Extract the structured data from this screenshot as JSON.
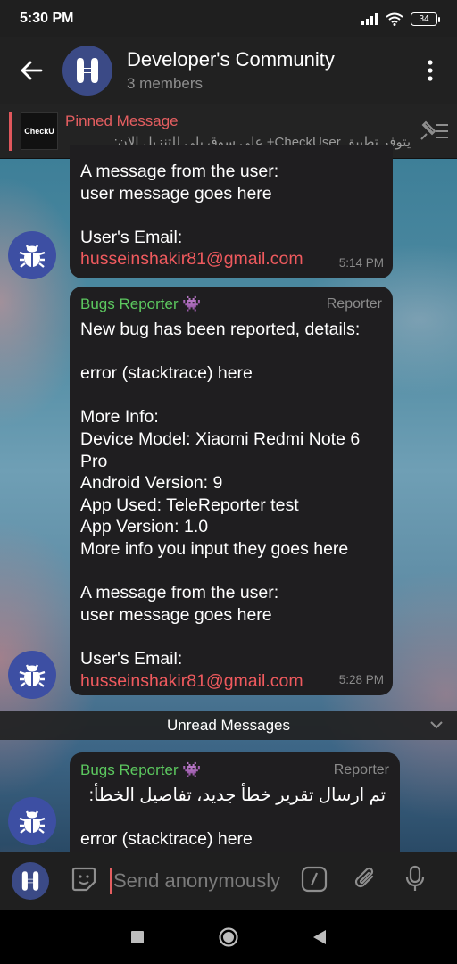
{
  "status_bar": {
    "time": "5:30 PM",
    "battery": "34"
  },
  "header": {
    "title": "Developer's Community",
    "subtitle": "3 members"
  },
  "pinned": {
    "label": "Pinned Message",
    "thumb_text": "CheckU",
    "text": "يتوفر تطبيق CheckUser+ على سوق بلي للتنزيل الان:..."
  },
  "messages": [
    {
      "lines": [
        "A message from the user:",
        "user message goes here",
        "",
        "User's Email:"
      ],
      "email": "husseinshakir81@gmail.com",
      "time": "5:14 PM"
    },
    {
      "sender": "Bugs Reporter 👾",
      "role": "Reporter",
      "lines": [
        "New bug has been reported, details:",
        "",
        "error (stacktrace) here",
        "",
        "More Info:",
        "Device Model: Xiaomi Redmi Note 6",
        "Pro",
        "Android Version: 9",
        "App Used: TeleReporter test",
        "App Version: 1.0",
        "More info you input they goes here",
        "",
        "A message from the user:",
        "user message goes here",
        "",
        "User's Email:"
      ],
      "email": "husseinshakir81@gmail.com",
      "time": "5:28 PM"
    },
    {
      "sender": "Bugs Reporter 👾",
      "role": "Reporter",
      "rtl_line": "تم ارسال تقرير خطأ جديد، تفاصيل الخطأ:",
      "lines": [
        "",
        "error (stacktrace) here"
      ]
    }
  ],
  "unread_label": "Unread Messages",
  "input": {
    "placeholder": "Send anonymously"
  },
  "colors": {
    "accent": "#e45e60",
    "sender": "#5cc85f",
    "bubble": "#1f1e20",
    "avatar": "#3d4fa3"
  }
}
